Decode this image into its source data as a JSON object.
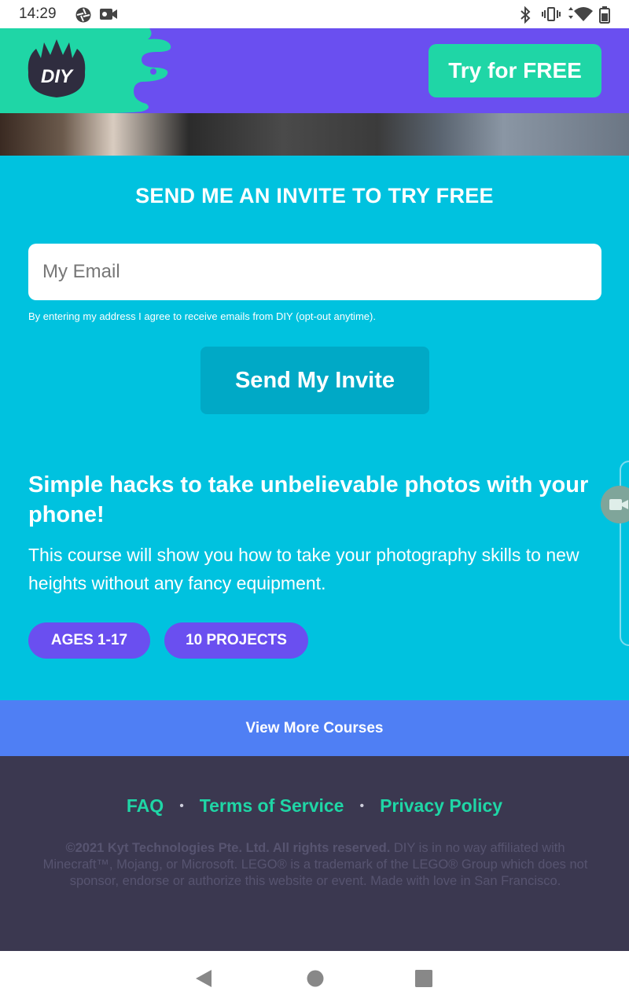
{
  "status_bar": {
    "time": "14:29",
    "icons": [
      "aperture-icon",
      "video-camera-icon",
      "bluetooth-icon",
      "vibrate-icon",
      "wifi-icon",
      "battery-icon"
    ]
  },
  "header": {
    "logo_text": "DIY",
    "cta_label": "Try for FREE"
  },
  "invite": {
    "heading": "SEND ME AN INVITE TO TRY FREE",
    "email_placeholder": "My Email",
    "email_value": "",
    "disclaimer": "By entering my address I agree to receive emails from DIY (opt-out anytime).",
    "submit_label": "Send My Invite"
  },
  "course": {
    "title": "Simple hacks to take unbelievable photos with your phone!",
    "description": "This course will show you how to take your photography skills to new heights without any fancy equipment.",
    "tags": [
      "AGES 1-17",
      "10 PROJECTS"
    ]
  },
  "view_more_label": "View More Courses",
  "footer": {
    "links": [
      "FAQ",
      "Terms of Service",
      "Privacy Policy"
    ],
    "separator": "•",
    "copyright_bold": "©2021 Kyt Technologies Pte. Ltd. All rights reserved.",
    "copyright_rest": " DIY is in no way affiliated with Minecraft™, Mojang, or Microsoft. LEGO® is a trademark of the LEGO® Group which does not sponsor, endorse or authorize this website or event. Made with love in San Francisco."
  },
  "colors": {
    "brand_purple": "#6a4ff0",
    "brand_green": "#1fd6a6",
    "main_cyan": "#00c2df",
    "button_blue": "#4f7ff4",
    "footer_bg": "#3b3850"
  }
}
